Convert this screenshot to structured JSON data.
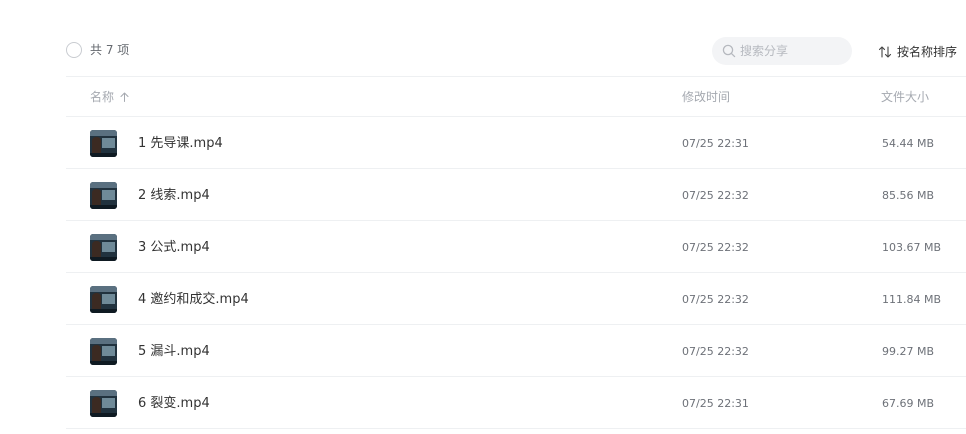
{
  "toolbar": {
    "count_label": "共 7 项",
    "search_placeholder": "搜索分享",
    "sort_label": "按名称排序"
  },
  "columns": {
    "name": "名称",
    "mtime": "修改时间",
    "size": "文件大小"
  },
  "files": [
    {
      "name": "1 先导课.mp4",
      "mtime": "07/25 22:31",
      "size": "54.44 MB"
    },
    {
      "name": "2 线索.mp4",
      "mtime": "07/25 22:32",
      "size": "85.56 MB"
    },
    {
      "name": "3 公式.mp4",
      "mtime": "07/25 22:32",
      "size": "103.67 MB"
    },
    {
      "name": "4 邀约和成交.mp4",
      "mtime": "07/25 22:32",
      "size": "111.84 MB"
    },
    {
      "name": "5 漏斗.mp4",
      "mtime": "07/25 22:32",
      "size": "99.27 MB"
    },
    {
      "name": "6 裂变.mp4",
      "mtime": "07/25 22:31",
      "size": "67.69 MB"
    }
  ],
  "icons": {
    "search": "search-icon",
    "sort": "sort-icon",
    "sort_direction": "arrow-up-icon",
    "thumbnail": "video-thumbnail"
  }
}
